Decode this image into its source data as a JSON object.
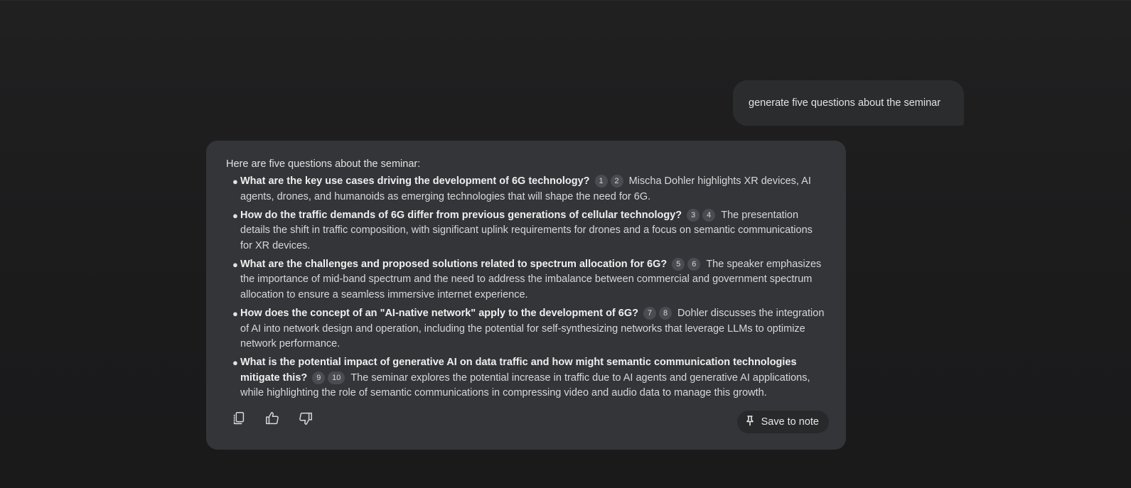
{
  "user_message": {
    "text": "generate five questions about the seminar"
  },
  "response": {
    "intro": "Here are five questions about the seminar:",
    "items": [
      {
        "title": "What are the key use cases driving the development of 6G technology?",
        "citations": [
          "1",
          "2"
        ],
        "text": "Mischa Dohler highlights XR devices, AI agents, drones, and humanoids as emerging technologies that will shape the need for 6G."
      },
      {
        "title": "How do the traffic demands of 6G differ from previous generations of cellular technology?",
        "citations": [
          "3",
          "4"
        ],
        "text": "The presentation details the shift in traffic composition, with significant uplink requirements for drones and a focus on semantic communications for XR devices."
      },
      {
        "title": "What are the challenges and proposed solutions related to spectrum allocation for 6G?",
        "citations": [
          "5",
          "6"
        ],
        "text": "The speaker emphasizes the importance of mid-band spectrum and the need to address the imbalance between commercial and government spectrum allocation to ensure a seamless immersive internet experience."
      },
      {
        "title": "How does the concept of an \"AI-native network\" apply to the development of 6G?",
        "citations": [
          "7",
          "8"
        ],
        "text": "Dohler discusses the integration of AI into network design and operation, including the potential for self-synthesizing networks that leverage LLMs to optimize network performance."
      },
      {
        "title": "What is the potential impact of generative AI on data traffic and how might semantic communication technologies mitigate this?",
        "citations": [
          "9",
          "10"
        ],
        "text": "The seminar explores the potential increase in traffic due to AI agents and generative AI applications, while highlighting the role of semantic communications in compressing video and audio data to manage this growth."
      }
    ],
    "actions": {
      "copy_icon": "copy-icon",
      "like_icon": "thumbs-up-icon",
      "dislike_icon": "thumbs-down-icon",
      "save_icon": "pin-icon",
      "save_label": "Save to note"
    }
  }
}
